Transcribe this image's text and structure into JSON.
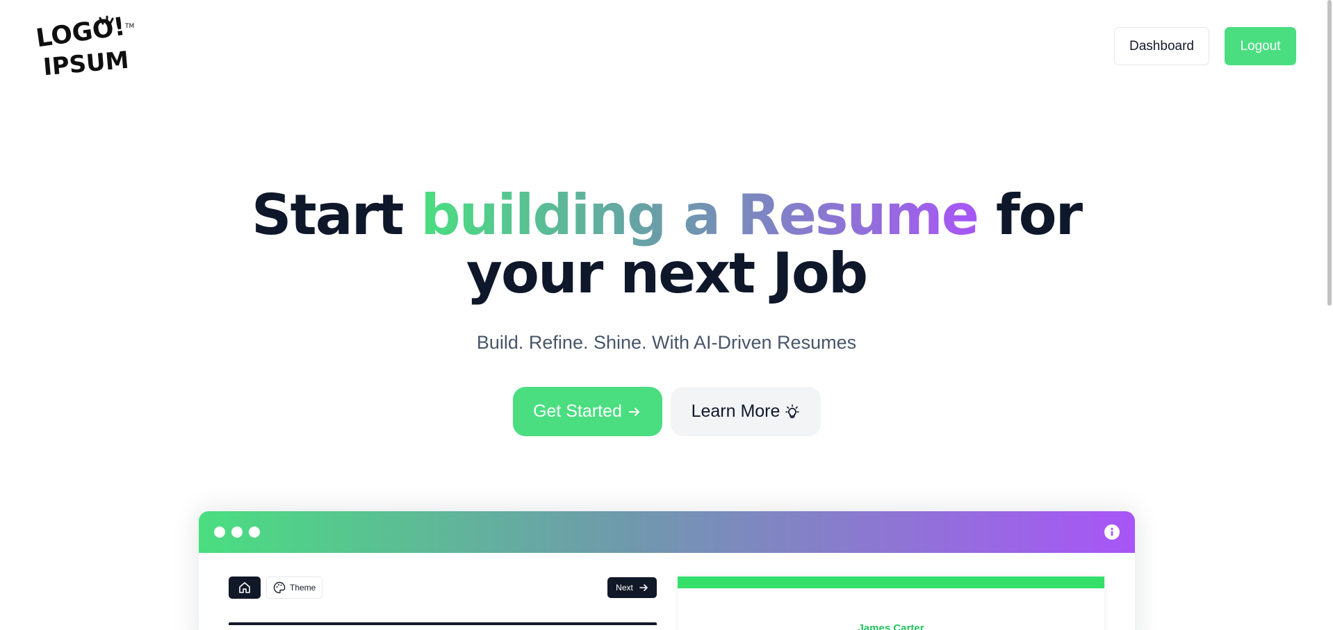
{
  "header": {
    "logo_alt": "LOGO IPSUM",
    "dashboard_label": "Dashboard",
    "logout_label": "Logout"
  },
  "hero": {
    "title_start": "Start",
    "title_gradient": "building a Resume",
    "title_for": "for",
    "title_line2": "your next Job",
    "subtitle": "Build. Refine. Shine. With AI-Driven Resumes",
    "get_started_label": "Get Started",
    "learn_more_label": "Learn More"
  },
  "preview": {
    "theme_label": "Theme",
    "next_label": "Next",
    "resume_name": "James Carter"
  },
  "colors": {
    "accent_green": "#4ade80",
    "accent_purple": "#a855f7",
    "dark": "#0f172a"
  }
}
